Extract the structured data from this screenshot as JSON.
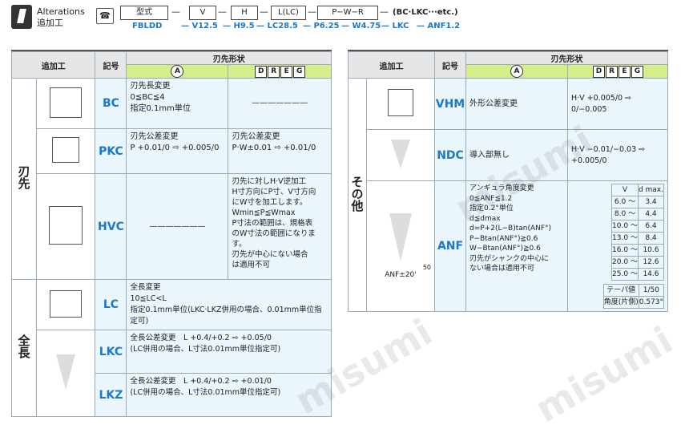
{
  "header": {
    "title_en": "Alterations",
    "title_jp": "追加工",
    "spec_boxes": [
      "型式",
      "V",
      "H",
      "L(LC)",
      "P−W−R"
    ],
    "spec_suffix": "(BC·LKC···etc.)",
    "code_values": [
      "FBLDD",
      "— V12.5",
      "— H9.5",
      "— LC28.5",
      "— P6.25",
      "— W4.75",
      "— LKC",
      "— ANF1.2"
    ]
  },
  "left_table": {
    "headers": {
      "col_addproc": "追加工",
      "col_code": "記号",
      "col_shape": "刃先形状",
      "sub_a": "A",
      "sub_dreg": [
        "D",
        "R",
        "E",
        "G"
      ]
    },
    "sections": [
      {
        "label": "刃先",
        "rows": [
          {
            "code": "BC",
            "desc_a": "刃先長変更\n0≦BC≦4\n指定0.1mm単位",
            "desc_dreg": "———————"
          },
          {
            "code": "PKC",
            "desc_a": "刃先公差変更\nP +0.01/0 ⇨ +0.005/0",
            "desc_dreg": "刃先公差変更\nP·W±0.01 ⇨ +0.01/0"
          },
          {
            "code": "HVC",
            "desc_a": "———————",
            "desc_dreg": "刃先に対しH·V逆加工\nH寸方向にP寸、V寸方向\nにW寸を加工します。\nWmin≦P≦Wmax\nP寸法の範囲は、規格表\nのW寸法の範囲になりま\nす。\n刃先が中心にない場合\nは適用不可"
          }
        ]
      },
      {
        "label": "全長",
        "rows": [
          {
            "code": "LC",
            "desc": "全長変更\n10≦LC<L\n指定0.1mm単位(LKC·LKZ併用の場合、0.01mm単位指定可)"
          },
          {
            "code": "LKC",
            "desc": "全長公差変更　L +0.4/+0.2 ⇨ +0.05/0\n(LC併用の場合、L寸法0.01mm単位指定可)"
          },
          {
            "code": "LKZ",
            "desc": "全長公差変更　L +0.4/+0.2 ⇨ +0.01/0\n(LC併用の場合、L寸法0.01mm単位指定可)"
          }
        ]
      }
    ]
  },
  "right_table": {
    "headers": {
      "col_addproc": "追加工",
      "col_code": "記号",
      "col_shape": "刃先形状",
      "sub_a": "A",
      "sub_dreg": [
        "D",
        "R",
        "E",
        "G"
      ]
    },
    "section_label": "その他",
    "rows": [
      {
        "code": "VHM",
        "desc": "外形公差変更",
        "formula": "H·V +0.005/0 ⇨ 0/−0.005"
      },
      {
        "code": "NDC",
        "desc": "導入部無し",
        "formula": "H·V −0.01/−0.03 ⇨ +0.005/0"
      },
      {
        "code": "ANF",
        "desc": "アンギュラ角度変更\n0≦ANF≦1.2\n指定0.2°単位\nd≦dmax\nd=P+2(L−B)tan(ANF°)\nP−Btan(ANF°)≧0.6\nW−Btan(ANF°)≧0.6\n刃先がシャンクの中心に\nない場合は適用不可",
        "fig_labels": {
          "angle": "50",
          "anf": "ANF±20'"
        },
        "dmax_table": {
          "headers": [
            "V",
            "d max."
          ],
          "rows": [
            [
              "6.0 ～",
              "3.4"
            ],
            [
              "8.0 ～",
              "4.4"
            ],
            [
              "10.0 ～",
              "6.4"
            ],
            [
              "13.0 ～",
              "8.4"
            ],
            [
              "16.0 ～",
              "10.6"
            ],
            [
              "20.0 ～",
              "12.6"
            ],
            [
              "25.0 ～",
              "14.6"
            ]
          ]
        },
        "taper": {
          "label1": "テーパ値",
          "val1": "1/50",
          "label2": "角度(片側)",
          "val2": "0.573°"
        }
      }
    ]
  },
  "watermark": "misumi"
}
